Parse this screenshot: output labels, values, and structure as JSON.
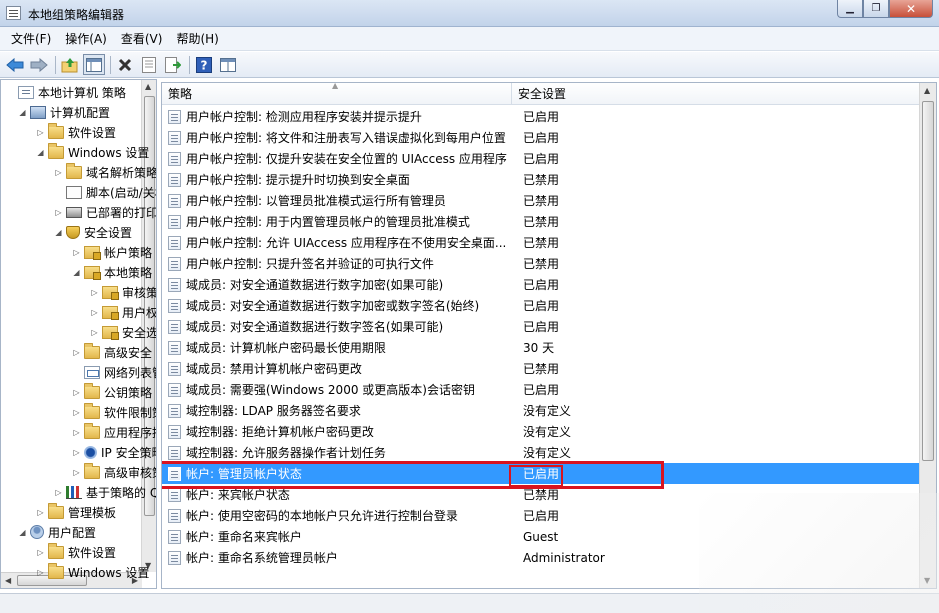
{
  "window": {
    "title": "本地组策略编辑器"
  },
  "window_buttons": {
    "minimize": "▁",
    "restore": "❐",
    "close": "✕"
  },
  "menu": [
    {
      "label": "文件(F)"
    },
    {
      "label": "操作(A)"
    },
    {
      "label": "查看(V)"
    },
    {
      "label": "帮助(H)"
    }
  ],
  "toolbar": {
    "back_icon": "back-arrow-icon",
    "forward_icon": "forward-arrow-icon",
    "up_icon": "up-folder-icon",
    "show_hide_tree_icon": "console-tree-icon",
    "delete_icon": "delete-icon",
    "properties_icon": "properties-icon",
    "export_icon": "export-list-icon",
    "help_icon": "help-icon",
    "extended_view_icon": "extended-view-icon"
  },
  "tree": [
    {
      "label": "本地计算机 策略",
      "icon": "policy",
      "twisty": "",
      "indent": 0
    },
    {
      "label": "计算机配置",
      "icon": "computer",
      "twisty": "◢",
      "indent": 1
    },
    {
      "label": "软件设置",
      "icon": "folder",
      "twisty": "▷",
      "indent": 2
    },
    {
      "label": "Windows 设置",
      "icon": "folder",
      "twisty": "◢",
      "indent": 2
    },
    {
      "label": "域名解析策略",
      "icon": "folder",
      "twisty": "▷",
      "indent": 3
    },
    {
      "label": "脚本(启动/关机)",
      "icon": "script",
      "twisty": "",
      "indent": 3
    },
    {
      "label": "已部署的打印机",
      "icon": "printer",
      "twisty": "▷",
      "indent": 3
    },
    {
      "label": "安全设置",
      "icon": "shield",
      "twisty": "◢",
      "indent": 3
    },
    {
      "label": "帐户策略",
      "icon": "lockfolder",
      "twisty": "▷",
      "indent": 4
    },
    {
      "label": "本地策略",
      "icon": "lockfolder",
      "twisty": "◢",
      "indent": 4
    },
    {
      "label": "审核策略",
      "icon": "lockfolder",
      "twisty": "▷",
      "indent": 5
    },
    {
      "label": "用户权限分配",
      "icon": "lockfolder",
      "twisty": "▷",
      "indent": 5
    },
    {
      "label": "安全选项",
      "icon": "lockfolder",
      "twisty": "▷",
      "indent": 5
    },
    {
      "label": "高级安全 Windows 防火墙",
      "icon": "folder",
      "twisty": "▷",
      "indent": 4
    },
    {
      "label": "网络列表管理器策略",
      "icon": "network",
      "twisty": "",
      "indent": 4
    },
    {
      "label": "公钥策略",
      "icon": "folder",
      "twisty": "▷",
      "indent": 4
    },
    {
      "label": "软件限制策略",
      "icon": "folder",
      "twisty": "▷",
      "indent": 4
    },
    {
      "label": "应用程序控制策略",
      "icon": "folder",
      "twisty": "▷",
      "indent": 4
    },
    {
      "label": "IP 安全策略",
      "icon": "ipsec",
      "twisty": "▷",
      "indent": 4
    },
    {
      "label": "高级审核策略配置",
      "icon": "folder",
      "twisty": "▷",
      "indent": 4
    },
    {
      "label": "基于策略的 QoS",
      "icon": "chart",
      "twisty": "▷",
      "indent": 3
    },
    {
      "label": "管理模板",
      "icon": "folder",
      "twisty": "▷",
      "indent": 2
    },
    {
      "label": "用户配置",
      "icon": "user",
      "twisty": "◢",
      "indent": 1
    },
    {
      "label": "软件设置",
      "icon": "folder",
      "twisty": "▷",
      "indent": 2
    },
    {
      "label": "Windows 设置",
      "icon": "folder",
      "twisty": "▷",
      "indent": 2
    }
  ],
  "columns": {
    "policy": "策略",
    "setting": "安全设置"
  },
  "rows": [
    {
      "policy": "用户帐户控制: 检测应用程序安装并提示提升",
      "setting": "已启用"
    },
    {
      "policy": "用户帐户控制: 将文件和注册表写入错误虚拟化到每用户位置",
      "setting": "已启用"
    },
    {
      "policy": "用户帐户控制: 仅提升安装在安全位置的 UIAccess 应用程序",
      "setting": "已启用"
    },
    {
      "policy": "用户帐户控制: 提示提升时切换到安全桌面",
      "setting": "已禁用"
    },
    {
      "policy": "用户帐户控制: 以管理员批准模式运行所有管理员",
      "setting": "已禁用"
    },
    {
      "policy": "用户帐户控制: 用于内置管理员帐户的管理员批准模式",
      "setting": "已禁用"
    },
    {
      "policy": "用户帐户控制: 允许 UIAccess 应用程序在不使用安全桌面...",
      "setting": "已禁用"
    },
    {
      "policy": "用户帐户控制: 只提升签名并验证的可执行文件",
      "setting": "已禁用"
    },
    {
      "policy": "域成员: 对安全通道数据进行数字加密(如果可能)",
      "setting": "已启用"
    },
    {
      "policy": "域成员: 对安全通道数据进行数字加密或数字签名(始终)",
      "setting": "已启用"
    },
    {
      "policy": "域成员: 对安全通道数据进行数字签名(如果可能)",
      "setting": "已启用"
    },
    {
      "policy": "域成员: 计算机帐户密码最长使用期限",
      "setting": "30 天"
    },
    {
      "policy": "域成员: 禁用计算机帐户密码更改",
      "setting": "已禁用"
    },
    {
      "policy": "域成员: 需要强(Windows 2000 或更高版本)会话密钥",
      "setting": "已启用"
    },
    {
      "policy": "域控制器: LDAP 服务器签名要求",
      "setting": "没有定义"
    },
    {
      "policy": "域控制器: 拒绝计算机帐户密码更改",
      "setting": "没有定义"
    },
    {
      "policy": "域控制器: 允许服务器操作者计划任务",
      "setting": "没有定义"
    },
    {
      "policy": "帐户: 管理员帐户状态",
      "setting": "已启用",
      "selected": true
    },
    {
      "policy": "帐户: 来宾帐户状态",
      "setting": "已禁用"
    },
    {
      "policy": "帐户: 使用空密码的本地帐户只允许进行控制台登录",
      "setting": "已启用"
    },
    {
      "policy": "帐户: 重命名来宾帐户",
      "setting": "Guest"
    },
    {
      "policy": "帐户: 重命名系统管理员帐户",
      "setting": "Administrator"
    }
  ],
  "colors": {
    "selection": "#3399ff",
    "annotation_box": "#d9141f"
  }
}
